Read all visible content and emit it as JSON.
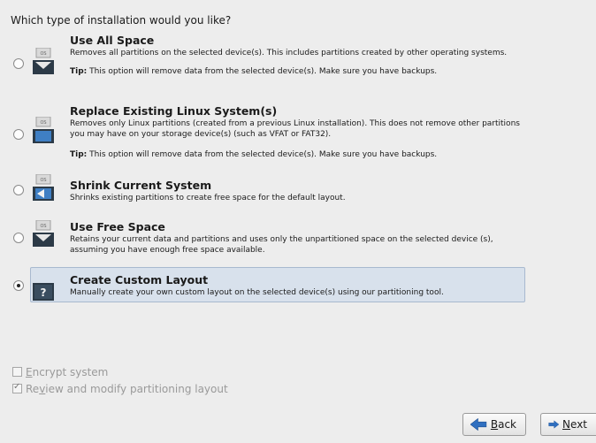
{
  "question": "Which type of installation would you like?",
  "options": [
    {
      "title": "Use All Space",
      "description": "Removes all partitions on the selected device(s).  This includes partitions created by other operating systems.",
      "tip_label": "Tip:",
      "tip_text": " This option will remove data from the selected device(s).  Make sure you have backups.",
      "icon": "os-drive-icon",
      "selected": false
    },
    {
      "title": "Replace Existing Linux System(s)",
      "description": "Removes only Linux partitions (created from a previous Linux installation).  This does not remove other partitions you may have on your storage device(s) (such as VFAT or FAT32).",
      "tip_label": "Tip:",
      "tip_text": " This option will remove data from the selected device(s).  Make sure you have backups.",
      "icon": "os-replace-icon",
      "selected": false
    },
    {
      "title": "Shrink Current System",
      "description": "Shrinks existing partitions to create free space for the default layout.",
      "icon": "os-shrink-icon",
      "selected": false
    },
    {
      "title": "Use Free Space",
      "description": "Retains your current data and partitions and uses only the unpartitioned space on the selected device (s), assuming you have enough free space available.",
      "icon": "os-free-space-icon",
      "selected": false
    },
    {
      "title": "Create Custom Layout",
      "description": "Manually create your own custom layout on the selected device(s) using our partitioning tool.",
      "icon": "custom-question-icon",
      "selected": true
    }
  ],
  "encrypt": {
    "mnemonic": "E",
    "rest": "ncrypt system",
    "checked": false
  },
  "review": {
    "pre": "Re",
    "mnemonic": "v",
    "rest": "iew and modify partitioning layout",
    "checked": true
  },
  "buttons": {
    "back": {
      "mnemonic": "B",
      "rest": "ack"
    },
    "next": {
      "mnemonic": "N",
      "rest": "ext"
    }
  },
  "colors": {
    "selected_bg": "#d8e1ec",
    "arrow_blue": "#2f6fc0"
  }
}
